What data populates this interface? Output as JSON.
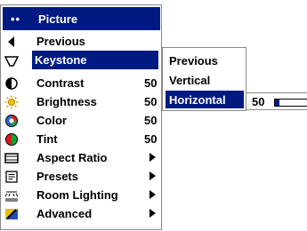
{
  "menu": {
    "header": {
      "dots": "••",
      "title": "Picture"
    },
    "items": [
      {
        "name": "previous",
        "label": "Previous",
        "value": "",
        "arrow": false,
        "icon": "back-arrow-icon"
      },
      {
        "name": "keystone",
        "label": "Keystone",
        "value": "",
        "arrow": true,
        "icon": "keystone-icon",
        "selected": true
      },
      {
        "name": "contrast",
        "label": "Contrast",
        "value": "50",
        "arrow": false,
        "icon": "contrast-icon"
      },
      {
        "name": "brightness",
        "label": "Brightness",
        "value": "50",
        "arrow": false,
        "icon": "brightness-sun-icon"
      },
      {
        "name": "color",
        "label": "Color",
        "value": "50",
        "arrow": false,
        "icon": "color-wheel-icon"
      },
      {
        "name": "tint",
        "label": "Tint",
        "value": "50",
        "arrow": false,
        "icon": "tint-icon"
      },
      {
        "name": "aspect-ratio",
        "label": "Aspect Ratio",
        "value": "",
        "arrow": true,
        "icon": "aspect-ratio-icon"
      },
      {
        "name": "presets",
        "label": "Presets",
        "value": "",
        "arrow": true,
        "icon": "presets-icon"
      },
      {
        "name": "room-lighting",
        "label": "Room Lighting",
        "value": "",
        "arrow": true,
        "icon": "room-lighting-icon"
      },
      {
        "name": "advanced",
        "label": "Advanced",
        "value": "",
        "arrow": true,
        "icon": "advanced-icon"
      }
    ]
  },
  "submenu": {
    "items": [
      {
        "label": "Previous"
      },
      {
        "label": "Vertical"
      },
      {
        "label": "Horizontal",
        "selected": true
      }
    ]
  },
  "slider": {
    "value": "50",
    "fraction": 0.12
  },
  "colors": {
    "accent": "#001a82",
    "background": "#ffffff",
    "border": "#8a8a8a"
  }
}
